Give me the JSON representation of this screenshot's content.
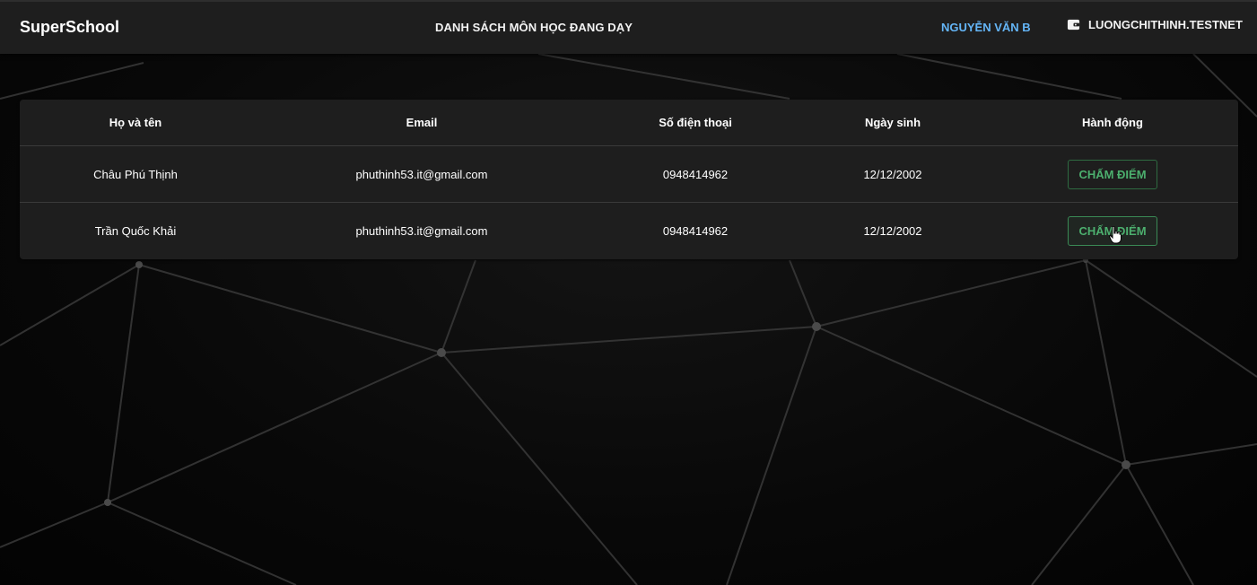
{
  "navbar": {
    "brand": "SuperSchool",
    "center_link": "DANH SÁCH MÔN HỌC ĐANG DẠY",
    "user_name": "NGUYỄN VĂN B",
    "wallet_icon": "wallet-icon",
    "wallet_label": "LUONGCHITHINH.TESTNET",
    "user_color": "#64b5f6"
  },
  "table": {
    "headers": [
      "Họ và tên",
      "Email",
      "Số điện thoại",
      "Ngày sinh",
      "Hành động"
    ],
    "rows": [
      {
        "name": "Châu Phú Thịnh",
        "email": "phuthinh53.it@gmail.com",
        "phone": "0948414962",
        "dob": "12/12/2002",
        "action": "CHẤM ĐIỂM"
      },
      {
        "name": "Trần Quốc Khải",
        "email": "phuthinh53.it@gmail.com",
        "phone": "0948414962",
        "dob": "12/12/2002",
        "action": "CHẤM ĐIỂM"
      }
    ]
  },
  "colors": {
    "accent_green": "#4caf6e",
    "navbar_bg": "#1e1e1e",
    "card_bg": "#1e1e1e"
  }
}
